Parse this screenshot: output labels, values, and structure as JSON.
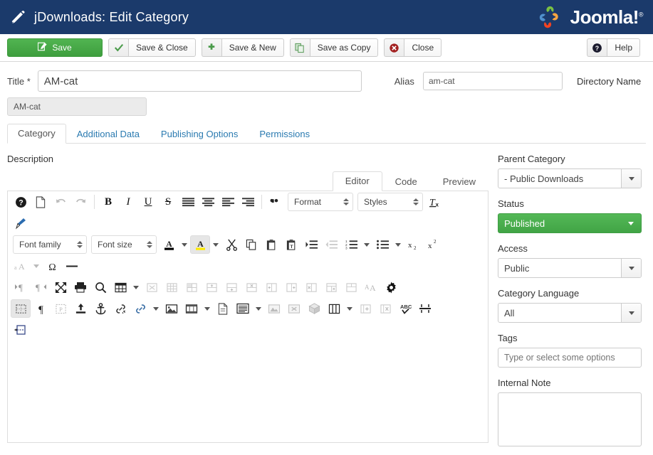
{
  "header": {
    "title": "jDownloads: Edit Category",
    "pencil_icon": "pencil-icon",
    "brand": "Joomla!",
    "brand_mark": "®",
    "bg_color": "#1b3a6b"
  },
  "toolbar": {
    "save_label": "Save",
    "save_icon": "save-pencil-square-icon",
    "save_close_label": "Save & Close",
    "save_close_icon": "check-icon",
    "save_new_label": "Save & New",
    "save_new_icon": "plus-icon",
    "save_copy_label": "Save as Copy",
    "save_copy_icon": "copy-icon",
    "close_label": "Close",
    "close_icon": "cancel-circle-icon",
    "help_label": "Help",
    "help_icon": "question-circle-icon",
    "save_color": "#46a546",
    "close_icon_color": "#a32121"
  },
  "form": {
    "title_label": "Title *",
    "title_value": "AM-cat",
    "alias_label": "Alias",
    "alias_value": "am-cat",
    "directory_name_label": "Directory Name",
    "directory_name_value": "AM-cat"
  },
  "tabs": [
    {
      "label": "Category",
      "active": true
    },
    {
      "label": "Additional Data",
      "active": false
    },
    {
      "label": "Publishing Options",
      "active": false
    },
    {
      "label": "Permissions",
      "active": false
    }
  ],
  "editor": {
    "description_label": "Description",
    "view_tabs": [
      {
        "label": "Editor",
        "active": true
      },
      {
        "label": "Code",
        "active": false
      },
      {
        "label": "Preview",
        "active": false
      }
    ],
    "format_select": "Format",
    "styles_select": "Styles",
    "font_family_select": "Font family",
    "font_size_select": "Font size",
    "content": ""
  },
  "sidebar": {
    "parent_category": {
      "label": "Parent Category",
      "value": "- Public Downloads"
    },
    "status": {
      "label": "Status",
      "value": "Published",
      "color": "#4caf50"
    },
    "access": {
      "label": "Access",
      "value": "Public"
    },
    "category_language": {
      "label": "Category Language",
      "value": "All"
    },
    "tags": {
      "label": "Tags",
      "placeholder": "Type or select some options",
      "value": ""
    },
    "internal_note": {
      "label": "Internal Note",
      "value": ""
    }
  }
}
